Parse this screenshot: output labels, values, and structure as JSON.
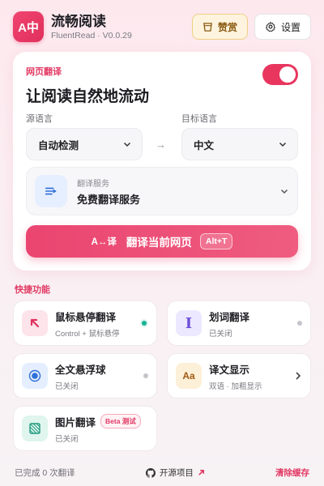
{
  "header": {
    "app_name": "流畅阅读",
    "app_sub": "FluentRead · V0.0.29",
    "logo_text": "A中",
    "donate_label": "赞赏",
    "settings_label": "设置"
  },
  "main": {
    "tag": "网页翻译",
    "title": "让阅读自然地流动",
    "toggle_on": true,
    "source_label": "源语言",
    "source_value": "自动检测",
    "target_label": "目标语言",
    "target_value": "中文",
    "service_label": "翻译服务",
    "service_value": "免费翻译服务",
    "translate_icon": "A↔译",
    "translate_label": "翻译当前网页",
    "shortcut": "Alt+T"
  },
  "quick": {
    "title": "快捷功能",
    "items": [
      {
        "title": "鼠标悬停翻译",
        "sub": "Control + 鼠标悬停",
        "status": "on"
      },
      {
        "title": "划词翻译",
        "sub": "已关闭",
        "status": "off"
      },
      {
        "title": "全文悬浮球",
        "sub": "已关闭",
        "status": "off"
      },
      {
        "title": "译文显示",
        "sub": "双语 · 加粗显示",
        "status": "more"
      },
      {
        "title": "图片翻译",
        "sub": "已关闭",
        "badge": "Beta 测试",
        "status": "none"
      }
    ]
  },
  "footer": {
    "count_text": "已完成 0 次翻译",
    "repo_text": "开源项目",
    "clear_text": "清除缓存"
  },
  "colors": {
    "accent": "#e8365f",
    "success": "#17b394"
  }
}
